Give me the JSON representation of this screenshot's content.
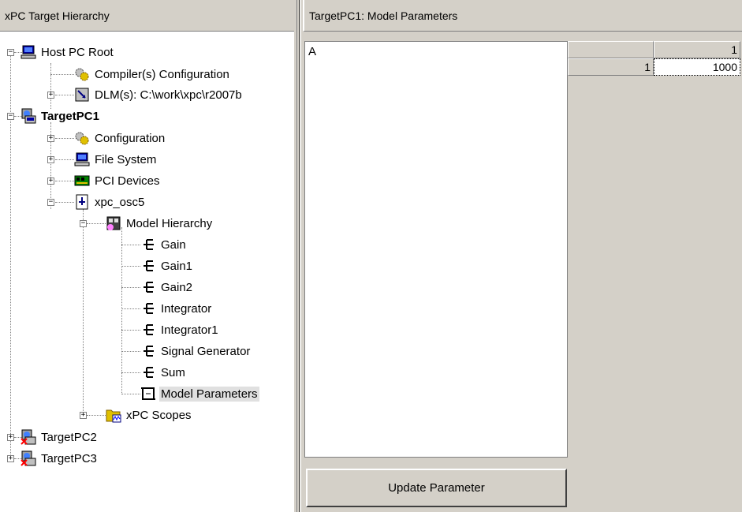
{
  "left_pane": {
    "title": "xPC Target Hierarchy"
  },
  "right_pane": {
    "title": "TargetPC1: Model Parameters"
  },
  "tree": {
    "host_pc_root": "Host PC Root",
    "compiler_config": "Compiler(s) Configuration",
    "dlm": "DLM(s): C:\\work\\xpc\\r2007b",
    "targetpc1": "TargetPC1",
    "configuration": "Configuration",
    "file_system": "File System",
    "pci_devices": "PCI Devices",
    "xpc_osc5": "xpc_osc5",
    "model_hierarchy": "Model Hierarchy",
    "blocks": [
      "Gain",
      "Gain1",
      "Gain2",
      "Integrator",
      "Integrator1",
      "Signal Generator",
      "Sum"
    ],
    "model_parameters": "Model Parameters",
    "xpc_scopes": "xPC Scopes",
    "targetpc2": "TargetPC2",
    "targetpc3": "TargetPC3"
  },
  "parameters": {
    "name": "A",
    "col_header": "1",
    "row_header": "1",
    "value": "1000"
  },
  "update_button": "Update Parameter",
  "colors": {
    "panel": "#d4d0c8",
    "selected": "#e0e0e0"
  }
}
